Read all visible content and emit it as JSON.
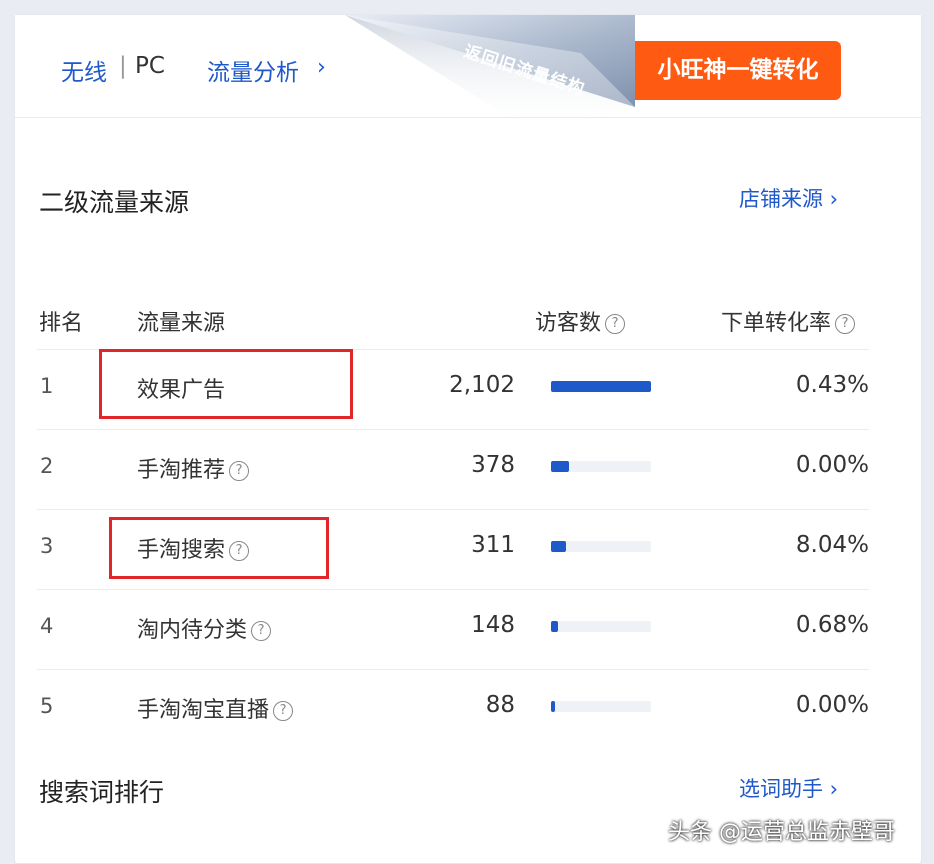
{
  "top_nav": {
    "wireless": "无线",
    "separator": "|",
    "pc": "PC",
    "flow_analysis": "流量分析",
    "chevron": "›"
  },
  "banner": {
    "curl_label": "返回旧流量结构",
    "one_click_button": "小旺神一键转化"
  },
  "secondary_source": {
    "title": "二级流量来源",
    "link": "店铺来源 ›"
  },
  "table": {
    "headers": {
      "rank": "排名",
      "source": "流量来源",
      "visitors": "访客数",
      "conversion": "下单转化率"
    },
    "rows": [
      {
        "rank": "1",
        "source": "效果广告",
        "visitors": "2,102",
        "bar_fraction": 1.0,
        "rate": "0.43%",
        "help": false
      },
      {
        "rank": "2",
        "source": "手淘推荐",
        "visitors": "378",
        "bar_fraction": 0.18,
        "rate": "0.00%",
        "help": true
      },
      {
        "rank": "3",
        "source": "手淘搜索",
        "visitors": "311",
        "bar_fraction": 0.15,
        "rate": "8.04%",
        "help": true
      },
      {
        "rank": "4",
        "source": "淘内待分类",
        "visitors": "148",
        "bar_fraction": 0.07,
        "rate": "0.68%",
        "help": true
      },
      {
        "rank": "5",
        "source": "手淘淘宝直播",
        "visitors": "88",
        "bar_fraction": 0.04,
        "rate": "0.00%",
        "help": true
      }
    ]
  },
  "search_rank": {
    "title": "搜索词排行",
    "link": "选词助手 ›"
  },
  "watermark": "头条 @运营总监赤壁哥",
  "colors": {
    "accent": "#1f58c8",
    "orange": "#ff5a12",
    "highlight_box": "#e1262a"
  }
}
